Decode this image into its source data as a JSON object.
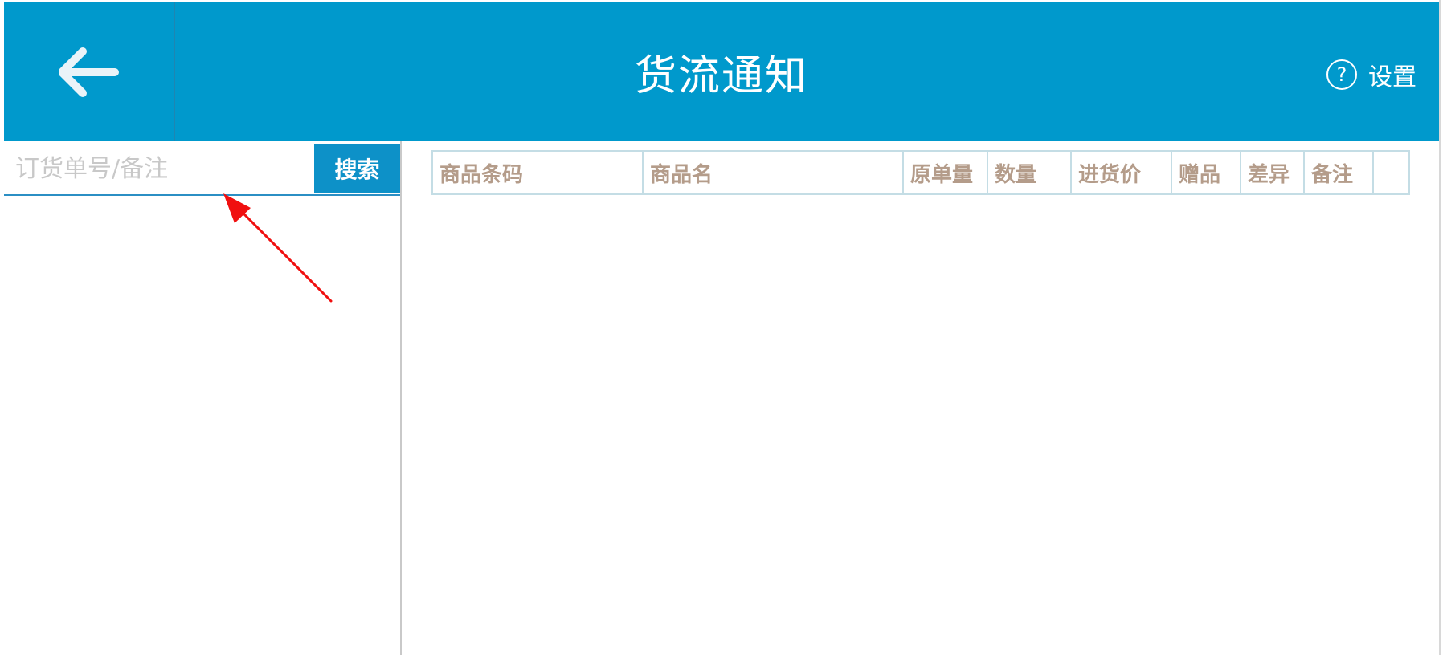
{
  "header": {
    "title": "货流通知",
    "settings_label": "设置",
    "back_icon": "arrow-left-icon",
    "help_icon": "question-circle-icon",
    "background_color": "#0099cc"
  },
  "search": {
    "placeholder": "订货单号/备注",
    "value": "",
    "button_label": "搜索"
  },
  "table": {
    "columns": [
      "商品条码",
      "商品名",
      "原单量",
      "数量",
      "进货价",
      "赠品",
      "差异",
      "备注",
      ""
    ],
    "rows": []
  },
  "annotation": {
    "type": "red-arrow",
    "color": "#ff0000"
  }
}
